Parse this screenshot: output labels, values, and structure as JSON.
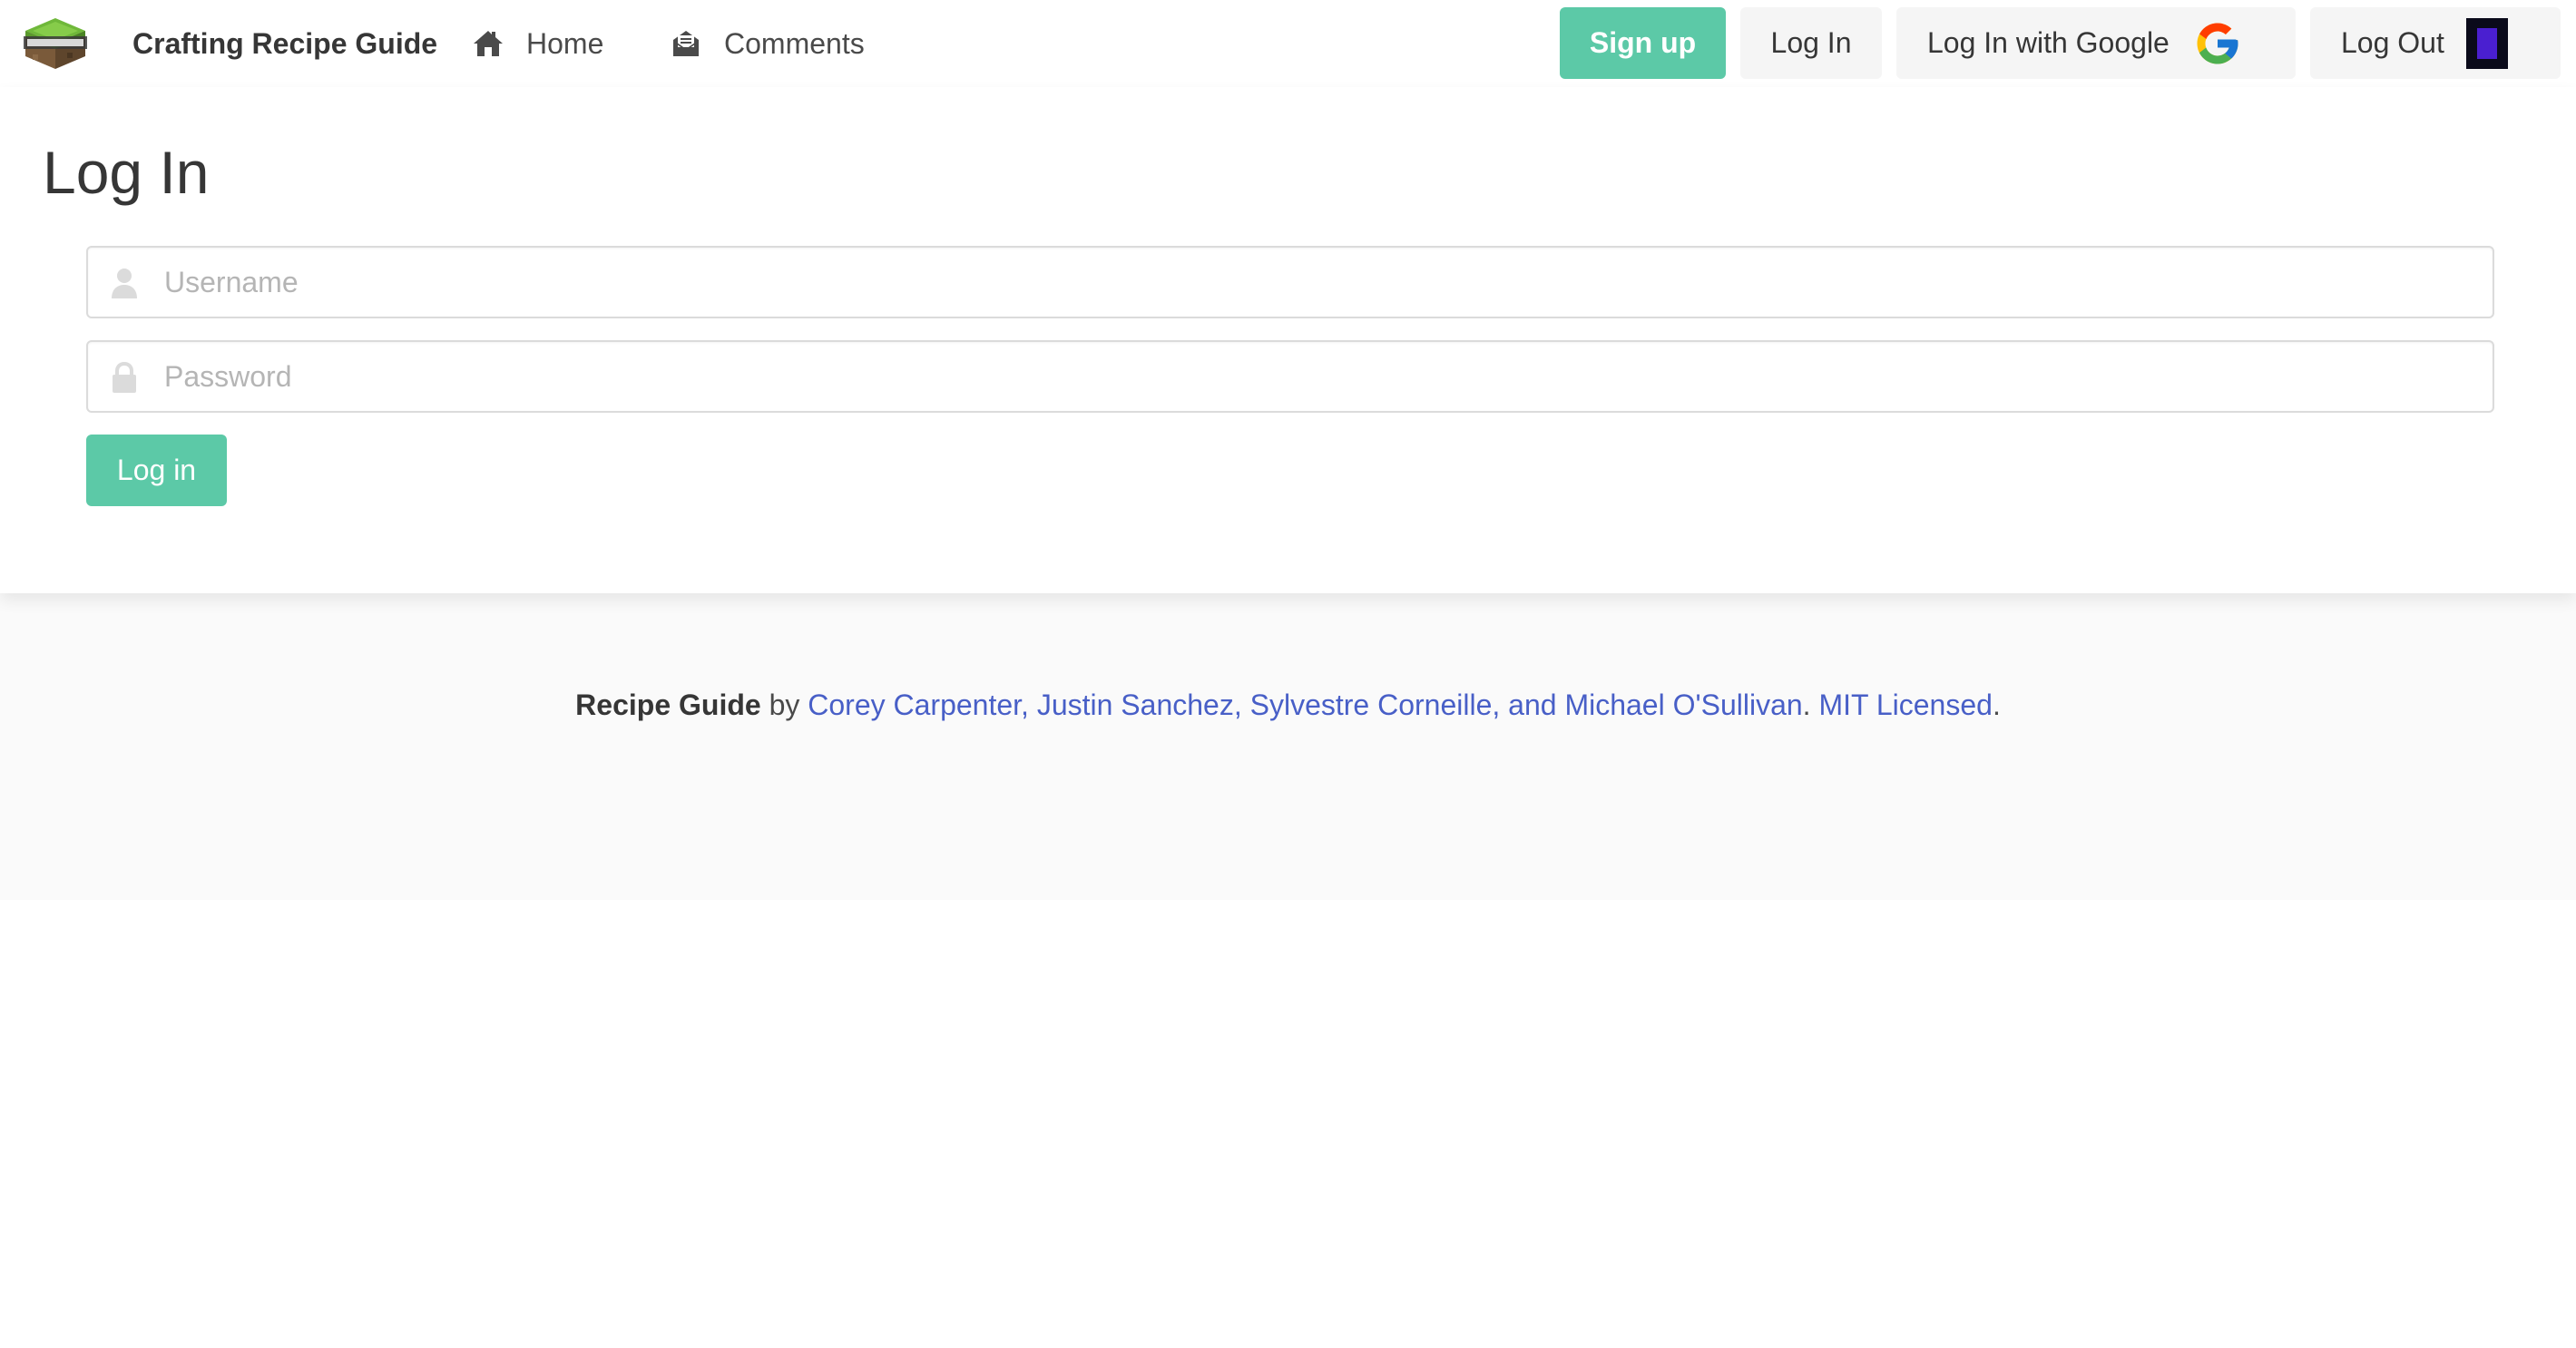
{
  "navbar": {
    "logo_icon": "minecraft-grass-block-logo",
    "brand": "Crafting Recipe Guide",
    "home_label": "Home",
    "home_icon": "home-icon",
    "comments_label": "Comments",
    "comments_icon": "envelope-open-icon",
    "signup_label": "Sign up",
    "login_label": "Log In",
    "google_login_label": "Log In with Google",
    "google_icon": "google-icon",
    "logout_label": "Log Out",
    "logout_avatar_icon": "user-avatar"
  },
  "main": {
    "title": "Log In",
    "username": {
      "placeholder": "Username",
      "value": "",
      "icon": "user-icon"
    },
    "password": {
      "placeholder": "Password",
      "value": "",
      "icon": "lock-icon"
    },
    "submit_label": "Log in"
  },
  "footer": {
    "app_name": "Recipe Guide",
    "by": " by ",
    "authors": "Corey Carpenter, Justin Sanchez, Sylvestre Corneille, and Michael O'Sullivan",
    "separator": ". ",
    "license": "MIT Licensed",
    "end": "."
  },
  "colors": {
    "primary": "#5cc9a7",
    "link": "#485fc7",
    "text": "#363636",
    "button_light": "#f5f5f5",
    "footer_bg": "#fafafa"
  }
}
